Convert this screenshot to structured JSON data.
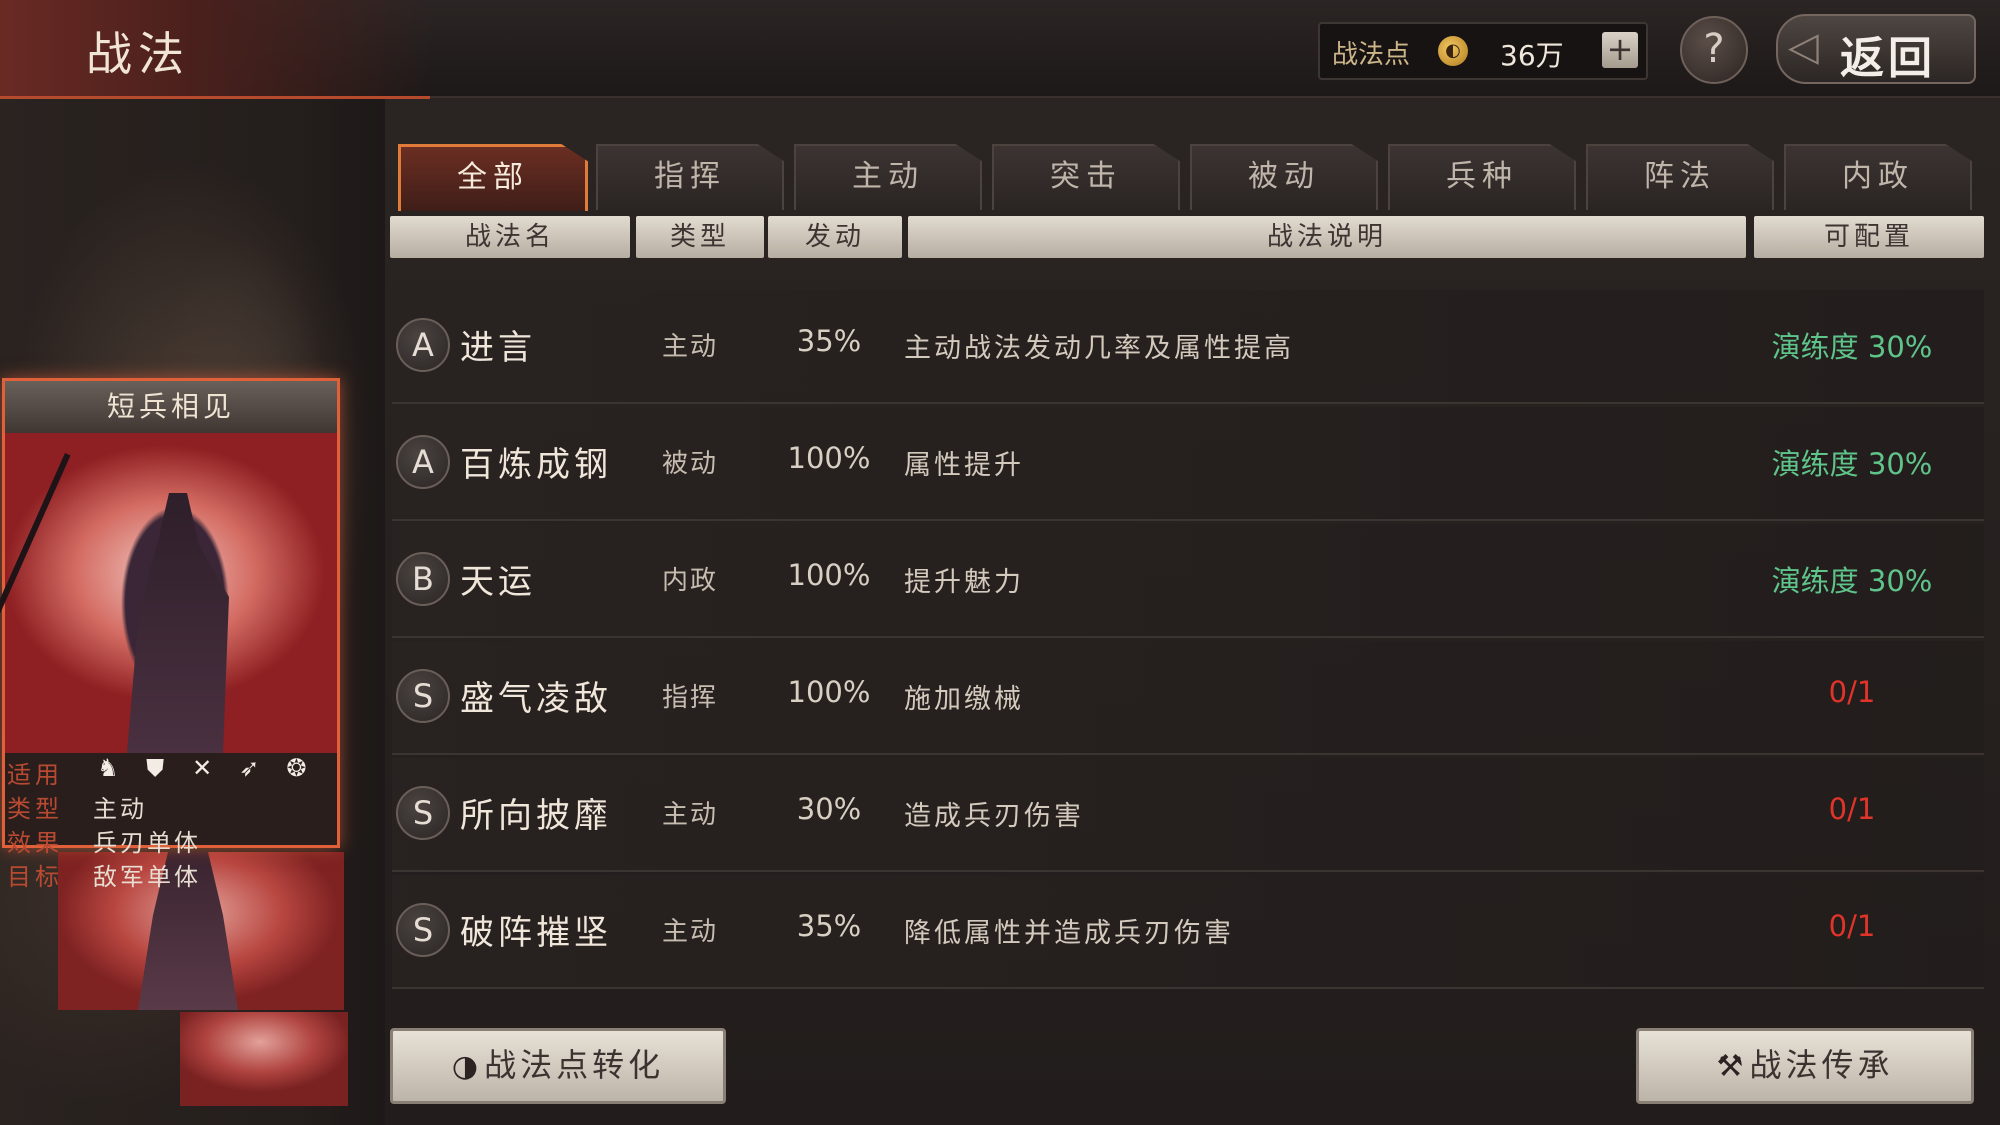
{
  "header": {
    "title": "战法",
    "points_label": "战法点",
    "points_value": "36万",
    "add_symbol": "+",
    "help_symbol": "?",
    "back_label": "返回",
    "back_arrow": "◁"
  },
  "tabs": [
    {
      "label": "全部",
      "active": true
    },
    {
      "label": "指挥",
      "active": false
    },
    {
      "label": "主动",
      "active": false
    },
    {
      "label": "突击",
      "active": false
    },
    {
      "label": "被动",
      "active": false
    },
    {
      "label": "兵种",
      "active": false
    },
    {
      "label": "阵法",
      "active": false
    },
    {
      "label": "内政",
      "active": false
    }
  ],
  "columns": {
    "name": "战法名",
    "type": "类型",
    "rate": "发动",
    "desc": "战法说明",
    "status": "可配置"
  },
  "skills": [
    {
      "grade": "A",
      "name": "进言",
      "type": "主动",
      "rate": "35%",
      "desc": "主动战法发动几率及属性提高",
      "status": "演练度 30%",
      "status_kind": "green"
    },
    {
      "grade": "A",
      "name": "百炼成钢",
      "type": "被动",
      "rate": "100%",
      "desc": "属性提升",
      "status": "演练度 30%",
      "status_kind": "green"
    },
    {
      "grade": "B",
      "name": "天运",
      "type": "内政",
      "rate": "100%",
      "desc": "提升魅力",
      "status": "演练度 30%",
      "status_kind": "green"
    },
    {
      "grade": "S",
      "name": "盛气凌敌",
      "type": "指挥",
      "rate": "100%",
      "desc": "施加缴械",
      "status": "0/1",
      "status_kind": "red"
    },
    {
      "grade": "S",
      "name": "所向披靡",
      "type": "主动",
      "rate": "30%",
      "desc": "造成兵刃伤害",
      "status": "0/1",
      "status_kind": "red"
    },
    {
      "grade": "S",
      "name": "破阵摧坚",
      "type": "主动",
      "rate": "35%",
      "desc": "降低属性并造成兵刃伤害",
      "status": "0/1",
      "status_kind": "red"
    }
  ],
  "card": {
    "title": "短兵相见",
    "applicable_label": "适用",
    "troop_icons": [
      "cavalry-icon",
      "shield-icon",
      "spear-icon",
      "bow-icon",
      "wheel-icon"
    ],
    "type_label": "类型",
    "type_value": "主动",
    "effect_label": "效果",
    "effect_value": "兵刃单体",
    "target_label": "目标",
    "target_value": "敌军单体"
  },
  "buttons": {
    "convert_label": "战法点转化",
    "inherit_label": "战法传承"
  },
  "colors": {
    "accent": "#e07b3a",
    "status_green": "#5fc48a",
    "status_red": "#e0342a"
  }
}
